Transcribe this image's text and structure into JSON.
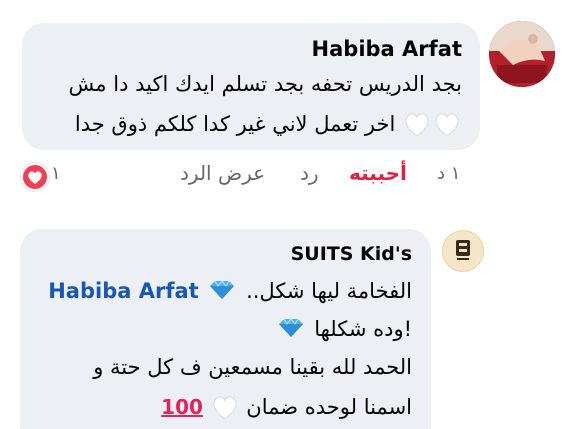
{
  "comment1": {
    "author": "Habiba Arfat",
    "line1": "بجد الدريس تحفه بجد تسلم ايدك اكيد دا مش",
    "line2": "اخر تعمل لاني غير كدا كلكم ذوق جدا",
    "avatar_icon": "profile-photo-red"
  },
  "actions": {
    "time": "١ د",
    "like_label": "أحببته",
    "reply_label": "رد",
    "view_replies_label": "عرض الرد",
    "reaction_count": "١",
    "reaction_icon": "heart-reaction-icon"
  },
  "comment2": {
    "author": "SUITS Kid's",
    "line1_text": "الفخامة ليها شكل..",
    "mention": "Habiba Arfat",
    "line2_text": "!وده شكلها",
    "line3": "الحمد لله بقينا مسمعين ف كل حتة و",
    "line4": "اسمنا لوحده ضمان",
    "emoji_100": "100",
    "avatar_icon": "suits-kids-logo"
  },
  "colors": {
    "bubble": "#eceff3",
    "like_red": "#e41e3f",
    "mention_blue": "#1958b0",
    "meta_gray": "#65676b"
  }
}
